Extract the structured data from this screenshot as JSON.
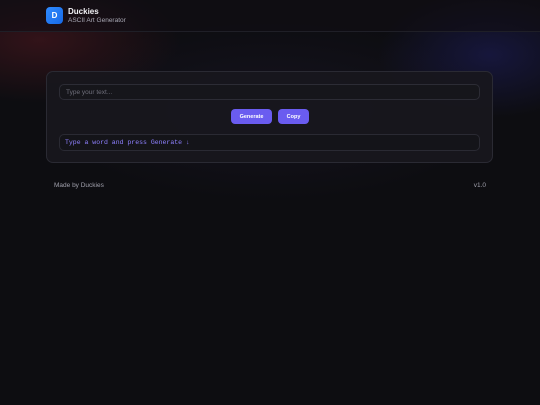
{
  "app": {
    "logo_letter": "D",
    "name": "Duckies",
    "subtitle": "ASCII Art Generator"
  },
  "input": {
    "placeholder": "Type your text...",
    "value": ""
  },
  "buttons": {
    "generate_label": "Generate",
    "copy_label": "Copy"
  },
  "output": {
    "text": "Type a word and press Generate ↓"
  },
  "footer": {
    "credit": "Made by Duckies",
    "version": "v1.0"
  },
  "colors": {
    "accent": "#6a5cf0",
    "logo": "#2f8bff",
    "output_text": "#8e80ff",
    "background": "#0d0d11"
  }
}
